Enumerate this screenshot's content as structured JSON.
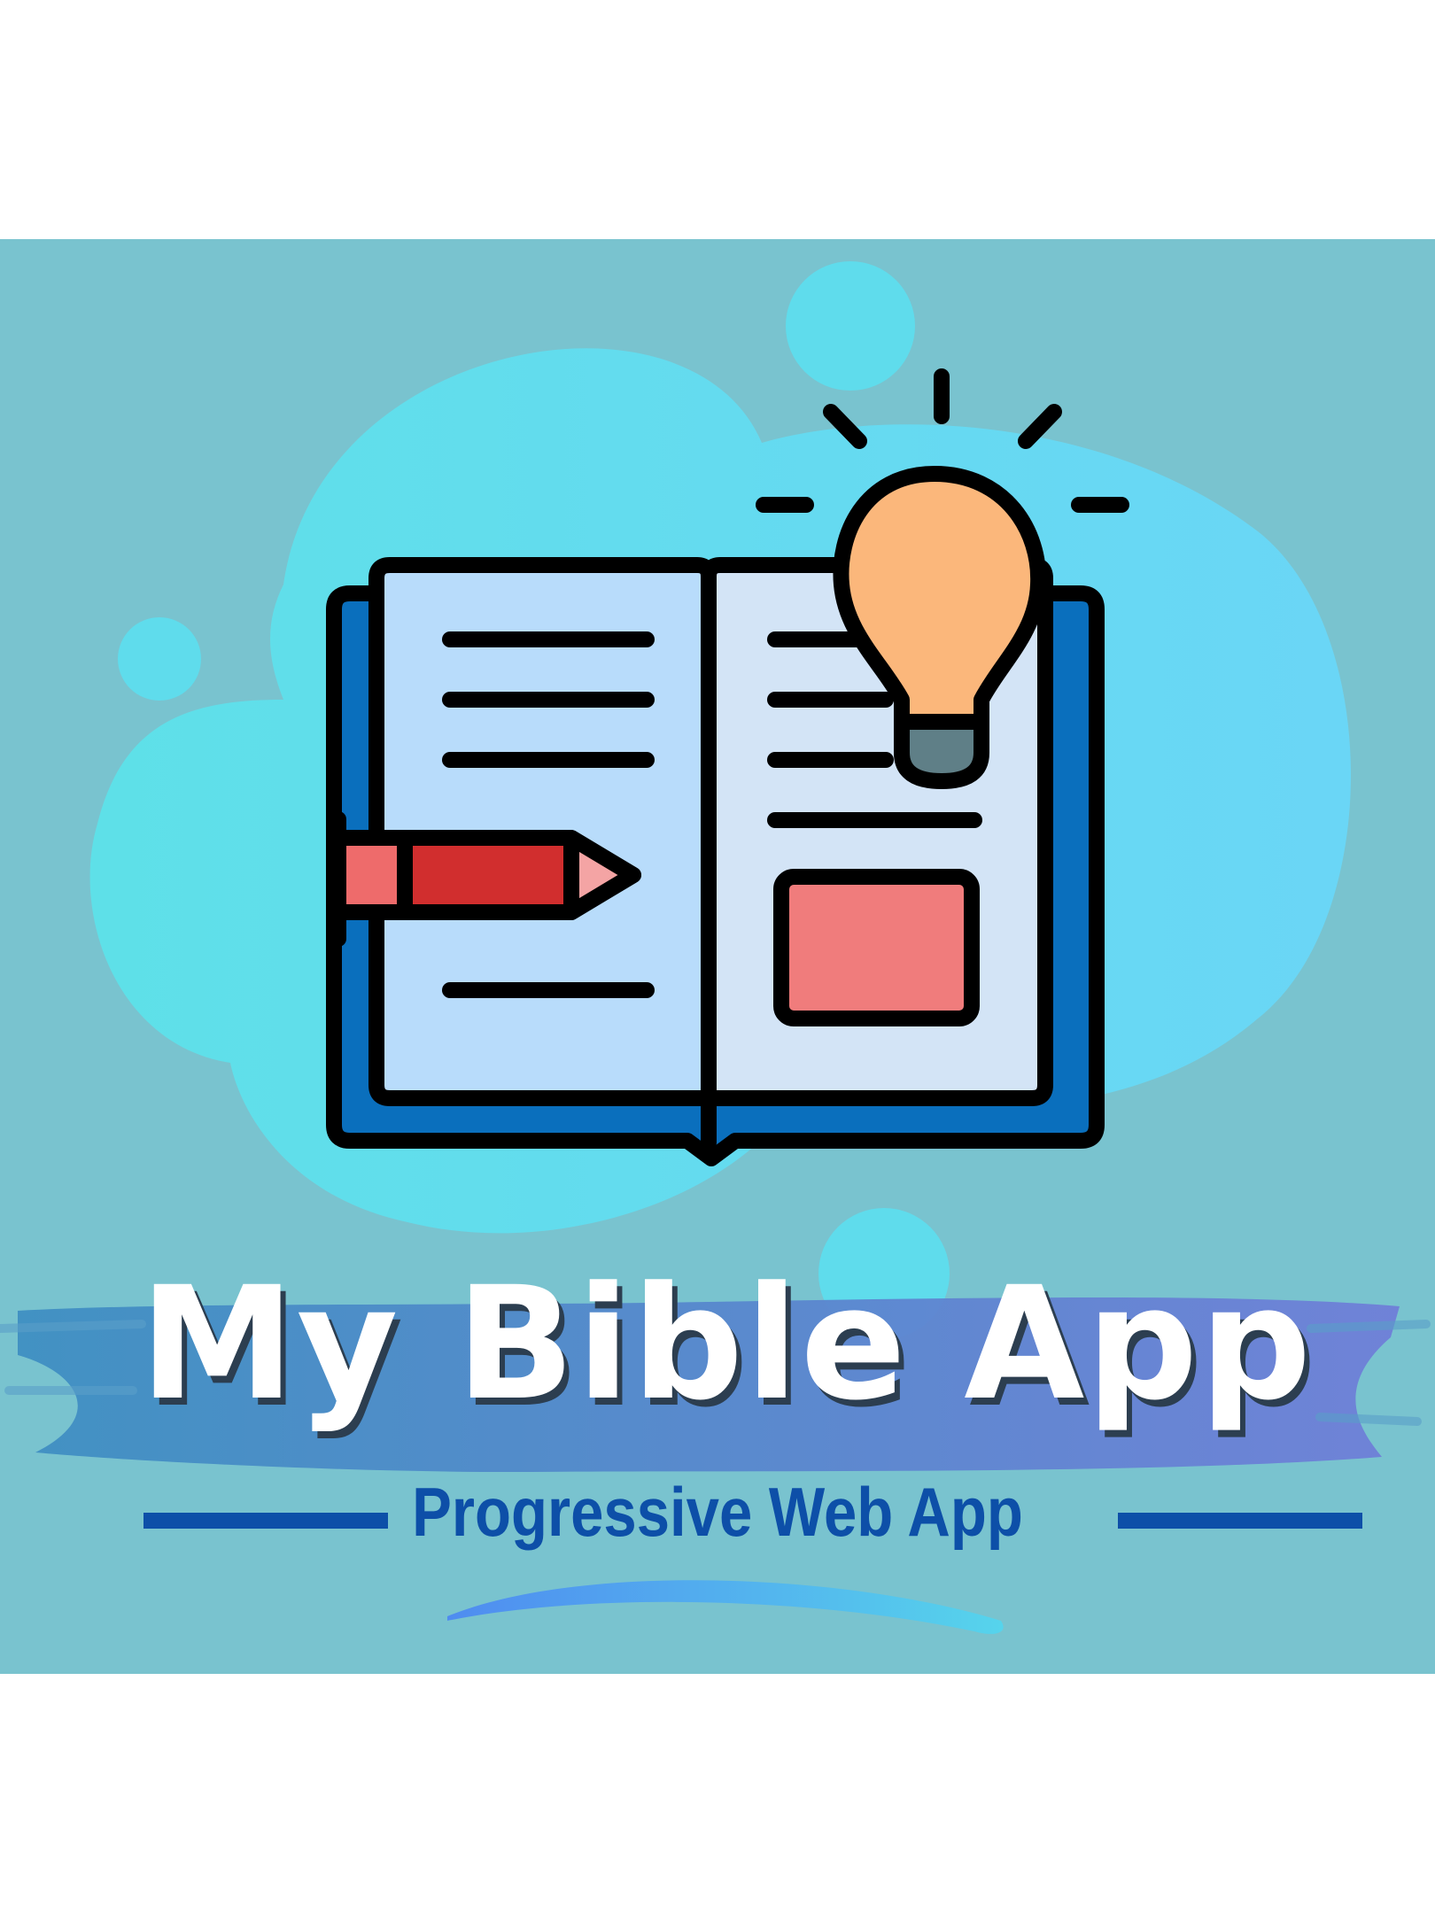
{
  "app": {
    "title": "My Bible App",
    "subtitle": "Progressive Web App"
  },
  "icons": {
    "book": "open-book-icon",
    "pencil": "pencil-icon",
    "lightbulb": "lightbulb-icon"
  },
  "colors": {
    "background": "#79c3cf",
    "blob": "#5fdcec",
    "brush": "#5b86d6",
    "title_text": "#ffffff",
    "subtitle_text": "#0d4fa8",
    "book_cover": "#0a6fbd",
    "page": "#b8dcfb",
    "pencil": "#d12e2e",
    "bulb": "#fbb77b"
  }
}
